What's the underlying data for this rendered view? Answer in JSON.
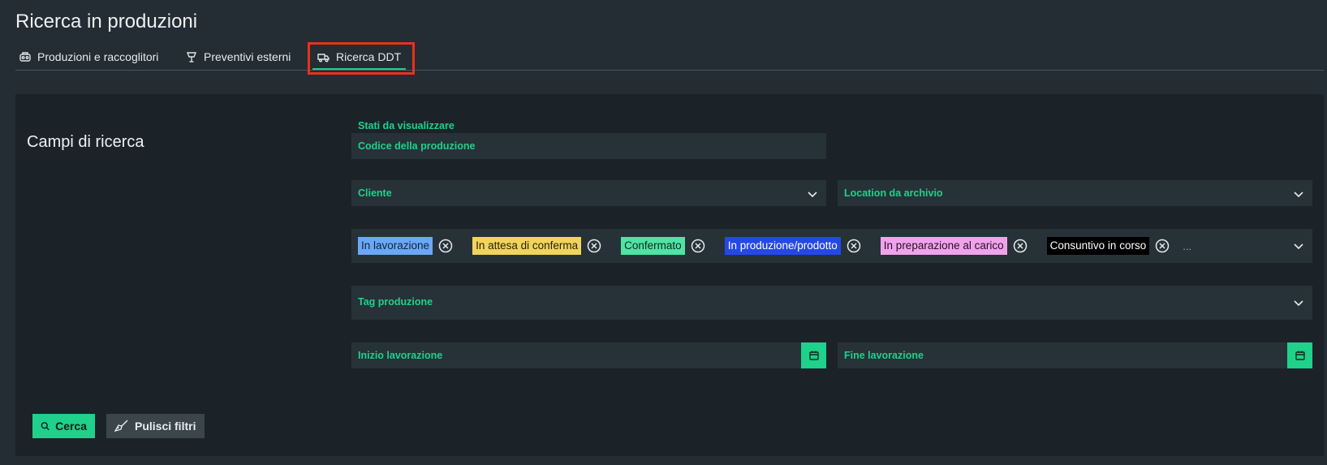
{
  "page": {
    "title": "Ricerca in produzioni"
  },
  "tabs": [
    {
      "label": "Produzioni e raccoglitori",
      "icon": "productions-icon"
    },
    {
      "label": "Preventivi esterni",
      "icon": "quotes-icon"
    },
    {
      "label": "Ricerca DDT",
      "icon": "ddt-search-icon",
      "active": true
    }
  ],
  "search": {
    "section_title": "Campi di ricerca",
    "production_code": {
      "label": "Codice della produzione"
    },
    "client": {
      "label": "Cliente"
    },
    "archive_location": {
      "label": "Location da archivio"
    },
    "states": {
      "label": "Stati da visualizzare",
      "chips": [
        {
          "label": "In lavorazione",
          "bg": "#6aa8f7",
          "fg": "#10243d"
        },
        {
          "label": "In attesa di conferma",
          "bg": "#f2d35b",
          "fg": "#2b2406"
        },
        {
          "label": "Confermato",
          "bg": "#4fe3a4",
          "fg": "#0d2b1f"
        },
        {
          "label": "In produzione/prodotto",
          "bg": "#2448e8",
          "fg": "#ffffff"
        },
        {
          "label": "In preparazione al carico",
          "bg": "#f0a3ec",
          "fg": "#2b0f29"
        },
        {
          "label": "Consuntivo in corso",
          "bg": "#000000",
          "fg": "#ffffff"
        }
      ],
      "more": "..."
    },
    "production_tag": {
      "label": "Tag produzione"
    },
    "start_date": {
      "label": "Inizio lavorazione"
    },
    "end_date": {
      "label": "Fine lavorazione"
    }
  },
  "actions": {
    "search_label": "Cerca",
    "clear_label": "Pulisci filtri"
  },
  "colors": {
    "accent": "#1fd18a",
    "highlight": "#e8321b"
  }
}
